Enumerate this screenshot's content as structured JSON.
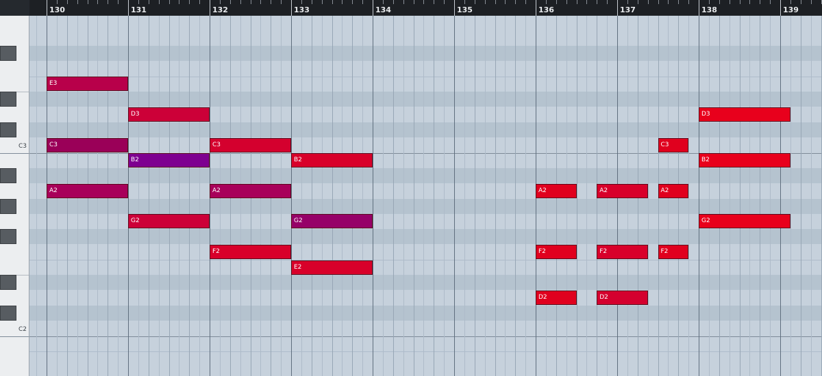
{
  "ruler": {
    "bars": [
      "130",
      "131",
      "132",
      "133",
      "134",
      "135",
      "136",
      "137",
      "138",
      "139"
    ]
  },
  "keyboard": {
    "octave_labels": [
      "C3",
      "C2"
    ]
  },
  "notes": [
    {
      "label": "E3",
      "pitch": "E3",
      "start": 130,
      "length": 1,
      "color": "#b8004a"
    },
    {
      "label": "C3",
      "pitch": "C3",
      "start": 130,
      "length": 1,
      "color": "#9a0058"
    },
    {
      "label": "A2",
      "pitch": "A2",
      "start": 130,
      "length": 1,
      "color": "#a8005a"
    },
    {
      "label": "D3",
      "pitch": "D3",
      "start": 131,
      "length": 1,
      "color": "#cc0038"
    },
    {
      "label": "B2",
      "pitch": "B2",
      "start": 131,
      "length": 1,
      "color": "#7e0090"
    },
    {
      "label": "G2",
      "pitch": "G2",
      "start": 131,
      "length": 1,
      "color": "#cc0038"
    },
    {
      "label": "C3",
      "pitch": "C3",
      "start": 132,
      "length": 1,
      "color": "#d4002e"
    },
    {
      "label": "A2",
      "pitch": "A2",
      "start": 132,
      "length": 1,
      "color": "#a8005a"
    },
    {
      "label": "F2",
      "pitch": "F2",
      "start": 132,
      "length": 1,
      "color": "#d8002a"
    },
    {
      "label": "B2",
      "pitch": "B2",
      "start": 133,
      "length": 1,
      "color": "#d8002a"
    },
    {
      "label": "G2",
      "pitch": "G2",
      "start": 133,
      "length": 1,
      "color": "#960068"
    },
    {
      "label": "E2",
      "pitch": "E2",
      "start": 133,
      "length": 1,
      "color": "#d8002a"
    },
    {
      "label": "A2",
      "pitch": "A2",
      "start": 136,
      "length": 0.5,
      "color": "#e0001e"
    },
    {
      "label": "F2",
      "pitch": "F2",
      "start": 136,
      "length": 0.5,
      "color": "#e0001e"
    },
    {
      "label": "D2",
      "pitch": "D2",
      "start": 136,
      "length": 0.5,
      "color": "#e0001e"
    },
    {
      "label": "A2",
      "pitch": "A2",
      "start": 136.75,
      "length": 0.625,
      "color": "#d8002a"
    },
    {
      "label": "F2",
      "pitch": "F2",
      "start": 136.75,
      "length": 0.625,
      "color": "#d8002a"
    },
    {
      "label": "D2",
      "pitch": "D2",
      "start": 136.75,
      "length": 0.625,
      "color": "#d4002e"
    },
    {
      "label": "C3",
      "pitch": "C3",
      "start": 137.5,
      "length": 0.375,
      "color": "#e0001e"
    },
    {
      "label": "A2",
      "pitch": "A2",
      "start": 137.5,
      "length": 0.375,
      "color": "#e0001e"
    },
    {
      "label": "F2",
      "pitch": "F2",
      "start": 137.5,
      "length": 0.375,
      "color": "#e0001e"
    },
    {
      "label": "D3",
      "pitch": "D3",
      "start": 138,
      "length": 1.125,
      "color": "#e8001c"
    },
    {
      "label": "B2",
      "pitch": "B2",
      "start": 138,
      "length": 1.125,
      "color": "#e8001c"
    },
    {
      "label": "G2",
      "pitch": "G2",
      "start": 138,
      "length": 1.125,
      "color": "#e8001c"
    }
  ]
}
